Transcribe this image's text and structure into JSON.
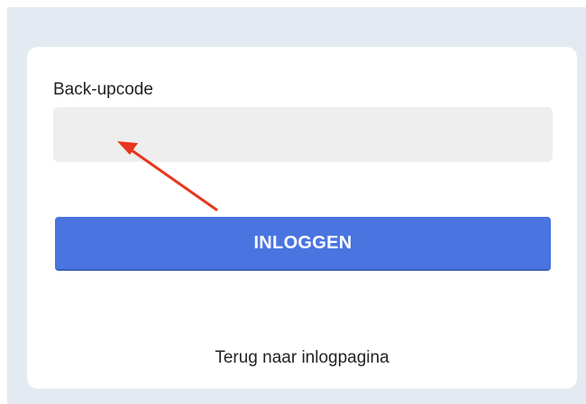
{
  "form": {
    "code_label": "Back-upcode",
    "code_value": "",
    "submit_label": "INLOGGEN",
    "back_link_label": "Terug naar inlogpagina"
  },
  "annotation": {
    "icon": "arrow-icon",
    "color": "#e8361e"
  },
  "colors": {
    "backdrop": "#e3eaf2",
    "card": "#ffffff",
    "input_background": "#eeeeee",
    "button": "#4a74e0",
    "button_text": "#ffffff"
  }
}
